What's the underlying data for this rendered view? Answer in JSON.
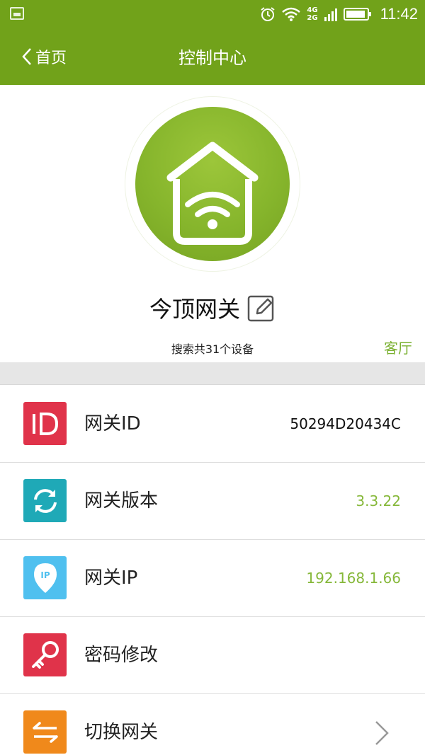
{
  "status_bar": {
    "time": "11:42",
    "network_top": "4G",
    "network_bottom": "2G",
    "icons": [
      "gallery-notification-icon",
      "alarm-icon",
      "wifi-icon",
      "signal-icon",
      "battery-icon"
    ]
  },
  "nav": {
    "back_label": "首页",
    "title": "控制中心"
  },
  "header": {
    "gateway_name": "今顶网关",
    "device_count": "搜索共31个设备",
    "room": "客厅"
  },
  "items": [
    {
      "label": "网关ID",
      "value": "50294D20434C",
      "icon": "id-icon",
      "icon_color": "#e0334a",
      "value_color": "#111111"
    },
    {
      "label": "网关版本",
      "value": "3.3.22",
      "icon": "refresh-icon",
      "icon_color": "#1fa9b7",
      "value_color": "#86b83a"
    },
    {
      "label": "网关IP",
      "value": "192.168.1.66",
      "icon": "ip-pin-icon",
      "icon_color": "#4fc0ef",
      "value_color": "#86b83a"
    },
    {
      "label": "密码修改",
      "value": "",
      "icon": "key-icon",
      "icon_color": "#e0334a"
    },
    {
      "label": "切换网关",
      "value": "",
      "icon": "switch-arrows-icon",
      "icon_color": "#f0891b"
    }
  ],
  "colors": {
    "brand_green": "#71a21a",
    "accent_green": "#86b83a"
  }
}
